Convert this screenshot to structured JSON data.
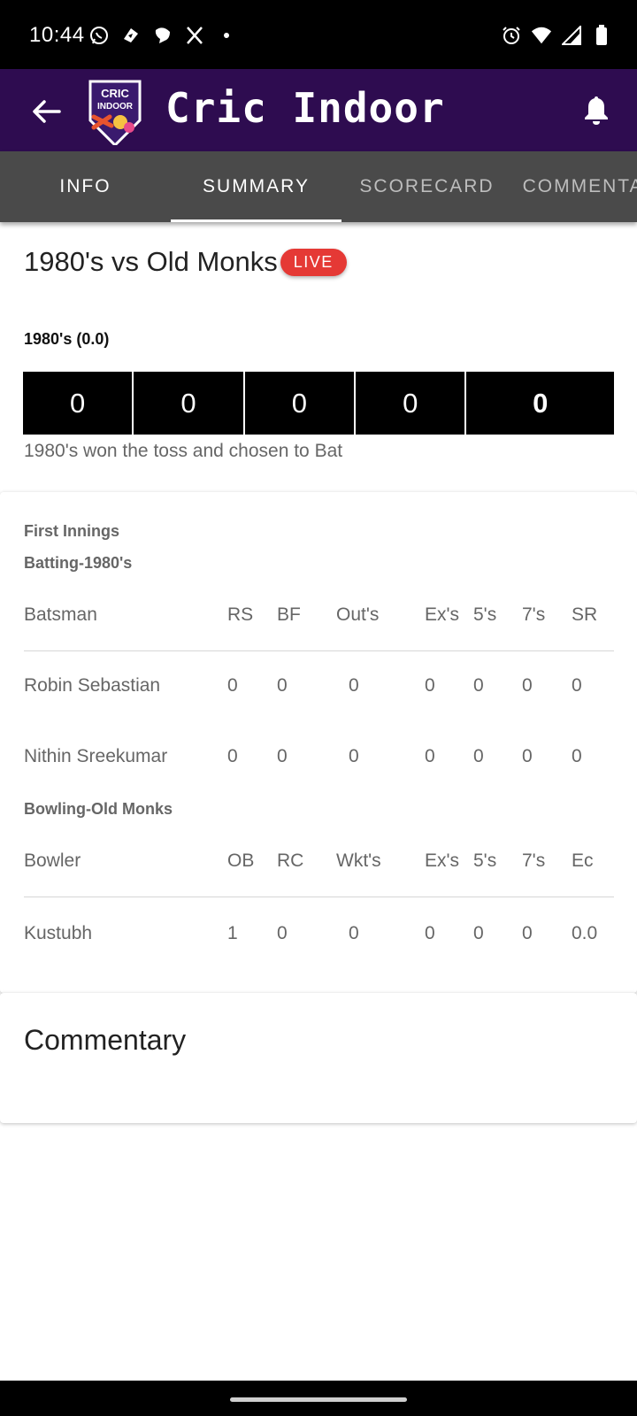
{
  "status_bar": {
    "time": "10:44",
    "left_icons": [
      "whatsapp-icon",
      "app-icon",
      "chat-icon",
      "x-icon",
      "dot-icon"
    ],
    "right_icons": [
      "alarm-icon",
      "wifi-icon",
      "signal-icon",
      "battery-icon"
    ]
  },
  "app_bar": {
    "title": "Cric Indoor",
    "logo_text_line1": "CRIC",
    "logo_text_line2": "INDOOR",
    "colors": {
      "background": "#2e0c50",
      "text": "#ffffff"
    }
  },
  "tabs": [
    {
      "label": "INFO",
      "active": false
    },
    {
      "label": "SUMMARY",
      "active": true
    },
    {
      "label": "SCORECARD",
      "active": false
    },
    {
      "label": "COMMENTARY",
      "active": false
    }
  ],
  "match": {
    "title": "1980's vs Old Monks",
    "live_label": "LIVE",
    "innings_score": "1980's (0.0)",
    "balls": [
      "0",
      "0",
      "0",
      "0",
      "0"
    ],
    "toss_text": "1980's won the toss and chosen to Bat"
  },
  "scorecard": {
    "innings_label": "First Innings",
    "batting_label": "Batting-1980's",
    "batting_headers": [
      "Batsman",
      "RS",
      "BF",
      "Out's",
      "Ex's",
      "5's",
      "7's",
      "SR"
    ],
    "batting_rows": [
      [
        "Robin Sebastian",
        "0",
        "0",
        "0",
        "0",
        "0",
        "0",
        "0"
      ],
      [
        "Nithin Sreekumar",
        "0",
        "0",
        "0",
        "0",
        "0",
        "0",
        "0"
      ]
    ],
    "bowling_label": "Bowling-Old Monks",
    "bowling_headers": [
      "Bowler",
      "OB",
      "RC",
      "Wkt's",
      "Ex's",
      "5's",
      "7's",
      "Ec"
    ],
    "bowling_rows": [
      [
        "Kustubh",
        "1",
        "0",
        "0",
        "0",
        "0",
        "0",
        "0.0"
      ]
    ]
  },
  "commentary": {
    "title": "Commentary"
  },
  "colors": {
    "live": "#e53935",
    "tabs_bg": "#4a4a4a"
  }
}
